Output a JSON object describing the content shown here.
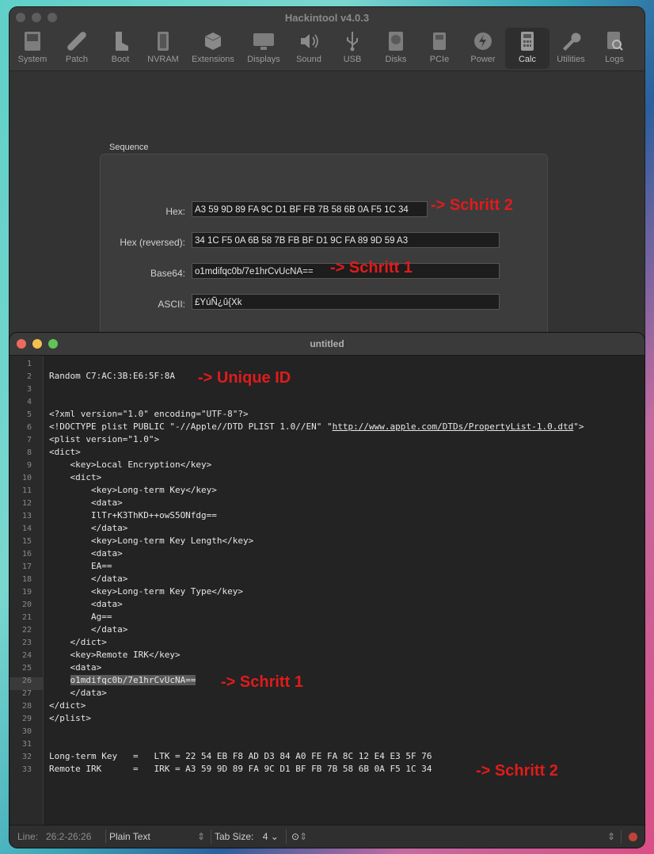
{
  "hackintool": {
    "title": "Hackintool v4.0.3",
    "toolbar": [
      {
        "label": "System",
        "icon": "system-icon"
      },
      {
        "label": "Patch",
        "icon": "patch-icon"
      },
      {
        "label": "Boot",
        "icon": "boot-icon"
      },
      {
        "label": "NVRAM",
        "icon": "nvram-icon"
      },
      {
        "label": "Extensions",
        "icon": "extensions-icon"
      },
      {
        "label": "Displays",
        "icon": "displays-icon"
      },
      {
        "label": "Sound",
        "icon": "sound-icon"
      },
      {
        "label": "USB",
        "icon": "usb-icon"
      },
      {
        "label": "Disks",
        "icon": "disks-icon"
      },
      {
        "label": "PCIe",
        "icon": "pcie-icon"
      },
      {
        "label": "Power",
        "icon": "power-icon"
      },
      {
        "label": "Calc",
        "icon": "calculator-icon"
      },
      {
        "label": "Utilities",
        "icon": "utilities-icon"
      },
      {
        "label": "Logs",
        "icon": "logs-icon"
      }
    ],
    "active_tab": "Calc",
    "sequence": {
      "title": "Sequence",
      "hex_label": "Hex:",
      "hex_value": "A3 59 9D 89 FA 9C D1 BF FB 7B 58 6B 0A F5 1C 34",
      "hex_rev_label": "Hex (reversed):",
      "hex_rev_value": "34 1C F5 0A 6B 58 7B FB BF D1 9C FA 89 9D 59 A3",
      "base64_label": "Base64:",
      "base64_value": "o1mdifqc0b/7e1hrCvUcNA==",
      "ascii_label": "ASCII:",
      "ascii_value": "£YúÑ¿û{Xk"
    },
    "annotations": {
      "hex": "-> Schritt 2",
      "base64": "-> Schritt 1"
    }
  },
  "editor": {
    "title": "untitled",
    "lines": [
      "",
      "Random C7:AC:3B:E6:5F:8A",
      "",
      "",
      "<?xml version=\"1.0\" encoding=\"UTF-8\"?>",
      "<!DOCTYPE plist PUBLIC \"-//Apple//DTD PLIST 1.0//EN\" \"http://www.apple.com/DTDs/PropertyList-1.0.dtd\">",
      "<plist version=\"1.0\">",
      "<dict>",
      "    <key>Local Encryption</key>",
      "    <dict>",
      "        <key>Long-term Key</key>",
      "        <data>",
      "        IlTr+K3ThKD++owS5ONfdg==",
      "        </data>",
      "        <key>Long-term Key Length</key>",
      "        <data>",
      "        EA==",
      "        </data>",
      "        <key>Long-term Key Type</key>",
      "        <data>",
      "        Ag==",
      "        </data>",
      "    </dict>",
      "    <key>Remote IRK</key>",
      "    <data>",
      "    o1mdifqc0b/7e1hrCvUcNA==",
      "    </data>",
      "</dict>",
      "</plist>",
      "",
      "",
      "Long-term Key   =   LTK = 22 54 EB F8 AD D3 84 A0 FE FA 8C 12 E4 E3 5F 76",
      "Remote IRK      =   IRK = A3 59 9D 89 FA 9C D1 BF FB 7B 58 6B 0A F5 1C 34"
    ],
    "annotations": {
      "unique_id": "-> Unique ID",
      "line26": "-> Schritt 1",
      "line33": "-> Schritt 2"
    },
    "status": {
      "line_label": "Line:",
      "line_value": "26:2-26:26",
      "syntax": "Plain Text",
      "tab_size_label": "Tab Size:",
      "tab_size_value": "4"
    }
  },
  "colors": {
    "annotation": "#e11b1b",
    "close": "#ed6a5e",
    "minimize": "#f5bf4f",
    "zoom": "#61c454"
  }
}
